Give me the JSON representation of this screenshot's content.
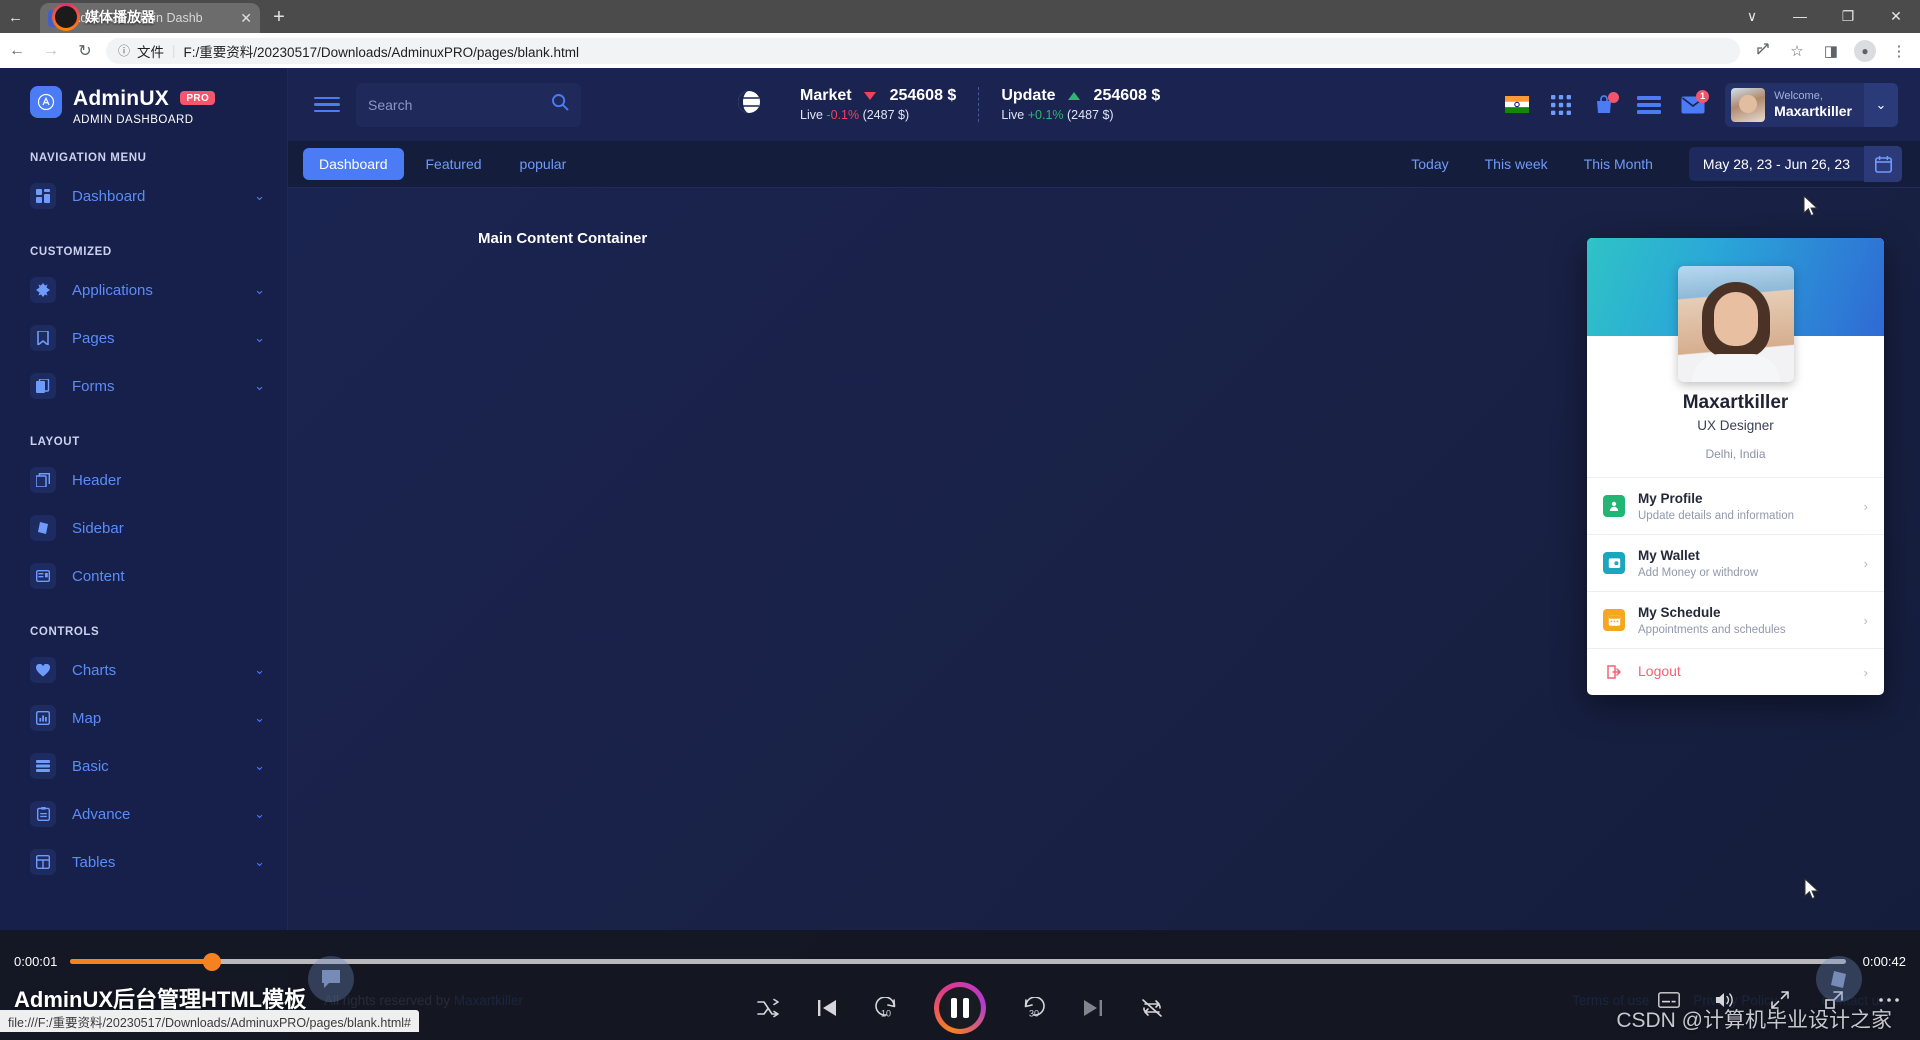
{
  "browser": {
    "tab_title": "AdminUX Admin Dashb",
    "tab_favicon_letter": "A",
    "tab_close": "✕",
    "new_tab": "+",
    "back_arrow": "←",
    "nav_back": "←",
    "nav_forward": "→",
    "nav_reload": "↻",
    "url_info_icon": "ⓘ",
    "url_kind": "文件",
    "url_separator": "|",
    "url": "F:/重要资料/20230517/Downloads/AdminuxPRO/pages/blank.html",
    "share_icon": "share-icon",
    "star_icon": "☆",
    "sidepanel_icon": "◨",
    "profile_icon": "●",
    "menu_icon": "⋮",
    "win_minimize": "—",
    "win_maximize": "❐",
    "win_close": "✕",
    "win_chevron": "∨"
  },
  "player_overlay": {
    "label": "媒体播放器"
  },
  "sidebar": {
    "brand_name": "AdminUX",
    "brand_badge": "PRO",
    "brand_sub": "ADMIN DASHBOARD",
    "groups": [
      {
        "title": "NAVIGATION MENU",
        "items": [
          {
            "label": "Dashboard",
            "icon": "dashboard-icon",
            "chevron": "⌄"
          }
        ]
      },
      {
        "title": "CUSTOMIZED",
        "items": [
          {
            "label": "Applications",
            "icon": "applications-icon",
            "chevron": "⌄"
          },
          {
            "label": "Pages",
            "icon": "pages-icon",
            "chevron": "⌄"
          },
          {
            "label": "Forms",
            "icon": "forms-icon",
            "chevron": "⌄"
          }
        ]
      },
      {
        "title": "LAYOUT",
        "items": [
          {
            "label": "Header",
            "icon": "header-icon",
            "chevron": ""
          },
          {
            "label": "Sidebar",
            "icon": "sidebar-icon",
            "chevron": ""
          },
          {
            "label": "Content",
            "icon": "content-icon",
            "chevron": ""
          }
        ]
      },
      {
        "title": "CONTROLS",
        "items": [
          {
            "label": "Charts",
            "icon": "heart-icon",
            "chevron": "⌄"
          },
          {
            "label": "Map",
            "icon": "map-icon",
            "chevron": "⌄"
          },
          {
            "label": "Basic",
            "icon": "basic-icon",
            "chevron": "⌄"
          },
          {
            "label": "Advance",
            "icon": "advance-icon",
            "chevron": "⌄"
          },
          {
            "label": "Tables",
            "icon": "tables-icon",
            "chevron": "⌄"
          }
        ]
      }
    ]
  },
  "topbar": {
    "menu_toggle": "hamburger-icon",
    "search_placeholder": "Search",
    "search_value": "",
    "search_icon": "search-icon",
    "globe_icon": "globe-icon",
    "tickers": [
      {
        "name": "Market",
        "direction": "down",
        "value": "254608 $",
        "live_label": "Live",
        "change": "-0.1%",
        "change_amount": "(2487 $)"
      },
      {
        "name": "Update",
        "direction": "up",
        "value": "254608 $",
        "live_label": "Live",
        "change": "+0.1%",
        "change_amount": "(2487 $)"
      }
    ],
    "icons": [
      {
        "name": "flag-india-icon",
        "badge": ""
      },
      {
        "name": "apps-grid-icon",
        "badge": ""
      },
      {
        "name": "shopping-bag-icon",
        "badge": ""
      },
      {
        "name": "list-icon",
        "badge": ""
      },
      {
        "name": "mail-icon",
        "badge": "1"
      }
    ],
    "user": {
      "welcome": "Welcome,",
      "name": "Maxartkiller",
      "chevron": "⌄"
    }
  },
  "subbar": {
    "tabs": [
      {
        "label": "Dashboard",
        "active": true
      },
      {
        "label": "Featured",
        "active": false
      },
      {
        "label": "popular",
        "active": false
      }
    ],
    "ranges": [
      "Today",
      "This week",
      "This Month"
    ],
    "date_range": "May 28, 23 - Jun 26, 23",
    "calendar_icon": "calendar-icon"
  },
  "content": {
    "title": "Main Content Container"
  },
  "footer": {
    "left_prefix": "All rights reserved by ",
    "left_author": "Maxartkiller",
    "links": [
      "Terms of use",
      "Privacy Policy",
      "Contact us"
    ]
  },
  "profile_popup": {
    "name": "Maxartkiller",
    "role": "UX Designer",
    "location": "Delhi, India",
    "items": [
      {
        "title": "My Profile",
        "sub": "Update details and information",
        "icon": "profile-icon",
        "color": "#22b573",
        "arrow": "›"
      },
      {
        "title": "My Wallet",
        "sub": "Add Money or withdrow",
        "icon": "wallet-icon",
        "color": "#1aa7bd",
        "arrow": "›"
      },
      {
        "title": "My Schedule",
        "sub": "Appointments and schedules",
        "icon": "calendar-icon",
        "color": "#f5a623",
        "arrow": "›"
      },
      {
        "title": "Logout",
        "sub": "",
        "icon": "logout-icon",
        "color": "#f26274",
        "arrow": "›"
      }
    ]
  },
  "player": {
    "time_current": "0:00:01",
    "time_total": "0:00:42",
    "progress_percent": 8,
    "title": "AdminUX后台管理HTML模板",
    "controls": [
      {
        "name": "shuffle-icon",
        "glyph": "⤨"
      },
      {
        "name": "previous-icon",
        "glyph": "❘◀"
      },
      {
        "name": "rewind-10-icon",
        "glyph": "10"
      },
      {
        "name": "pause-icon",
        "glyph": "⏸"
      },
      {
        "name": "forward-30-icon",
        "glyph": "30"
      },
      {
        "name": "next-icon",
        "glyph": "▶❘"
      },
      {
        "name": "repeat-off-icon",
        "glyph": "↻"
      }
    ],
    "right_controls": [
      {
        "name": "subtitles-icon",
        "glyph": "▤"
      },
      {
        "name": "volume-icon",
        "glyph": "␨"
      },
      {
        "name": "fullscreen-icon",
        "glyph": "⤢"
      },
      {
        "name": "pip-icon",
        "glyph": "❐"
      },
      {
        "name": "more-icon",
        "glyph": "⋯"
      }
    ]
  },
  "status_bar": {
    "text": "file:///F:/重要资料/20230517/Downloads/AdminuxPRO/pages/blank.html#"
  },
  "watermark": {
    "text": "CSDN @计算机毕业设计之家"
  },
  "colors": {
    "accent": "#4b7bf5",
    "sidebar_bg": "#17204a",
    "app_bg": "#151d3c",
    "negative": "#f0425c",
    "positive": "#2bb673",
    "badge": "#f4566b"
  }
}
